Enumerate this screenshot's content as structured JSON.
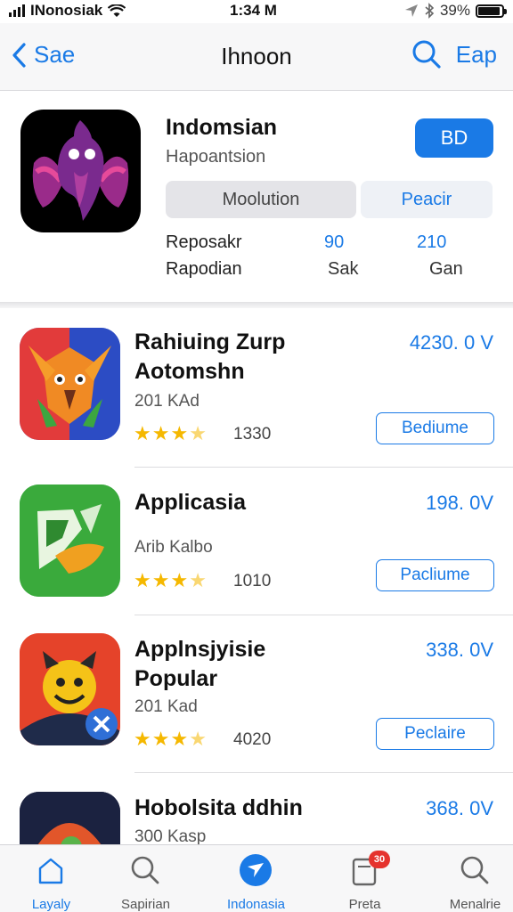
{
  "status_bar": {
    "carrier": "INonosiak",
    "time": "1:34 M",
    "battery": "39%"
  },
  "nav": {
    "back_label": "Sae",
    "title": "Ihnoon",
    "right_label": "Eap"
  },
  "featured": {
    "name": "Indomsian",
    "subtitle": "Hapoantsion",
    "get_label": "BD",
    "segment_left": "Moolution",
    "segment_right": "Peacir",
    "stats": [
      {
        "label": "Reposakr",
        "value": "90",
        "value2": "210"
      },
      {
        "label": "Rapodian",
        "value": "Sak",
        "value2": "Gan"
      }
    ]
  },
  "apps": [
    {
      "title_line1": "Rahiuing Zurp",
      "title_line2": "Aotomshn",
      "meta": "201 KAd",
      "rating_count": "1330",
      "price": "4230. 0 V",
      "button": "Bediume"
    },
    {
      "title_line1": "Applicasia",
      "title_line2": "",
      "meta": "Arib Kalbo",
      "rating_count": "1010",
      "price": "198. 0V",
      "button": "Pacliume"
    },
    {
      "title_line1": "Applnsjyisie",
      "title_line2": "Popular",
      "meta": "201 Kad",
      "rating_count": "4020",
      "price": "338. 0V",
      "button": "Peclaire"
    },
    {
      "title_line1": "Hobolsita ddhin",
      "title_line2": "",
      "meta": "300 Kasp",
      "rating_count": "",
      "price": "368. 0V",
      "button": ""
    }
  ],
  "tabs": [
    {
      "label": "Layaly",
      "icon": "home-icon"
    },
    {
      "label": "Sapirian",
      "icon": "search-icon"
    },
    {
      "label": "Indonasia",
      "icon": "compass-icon",
      "active": true
    },
    {
      "label": "Preta",
      "icon": "updates-icon",
      "badge": "30"
    },
    {
      "label": "Menalrie",
      "icon": "search-icon"
    }
  ],
  "colors": {
    "accent": "#1a7ae6",
    "star": "#f5b800",
    "badge": "#e5322d"
  }
}
